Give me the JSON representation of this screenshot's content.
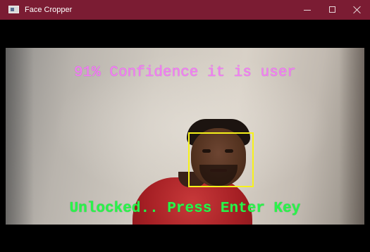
{
  "window": {
    "title": "Face Cropper",
    "controls": {
      "minimize_icon": "minimize-icon",
      "maximize_icon": "maximize-icon",
      "close_icon": "close-icon"
    }
  },
  "camera_feed": {
    "confidence_text": "91% Confidence it is user",
    "status_text": "Unlocked.. Press Enter Key",
    "colors": {
      "confidence_text": "#f27ef5",
      "status_text": "#29f54a",
      "face_box": "#f7f21a",
      "titlebar": "#7b1c33"
    }
  }
}
